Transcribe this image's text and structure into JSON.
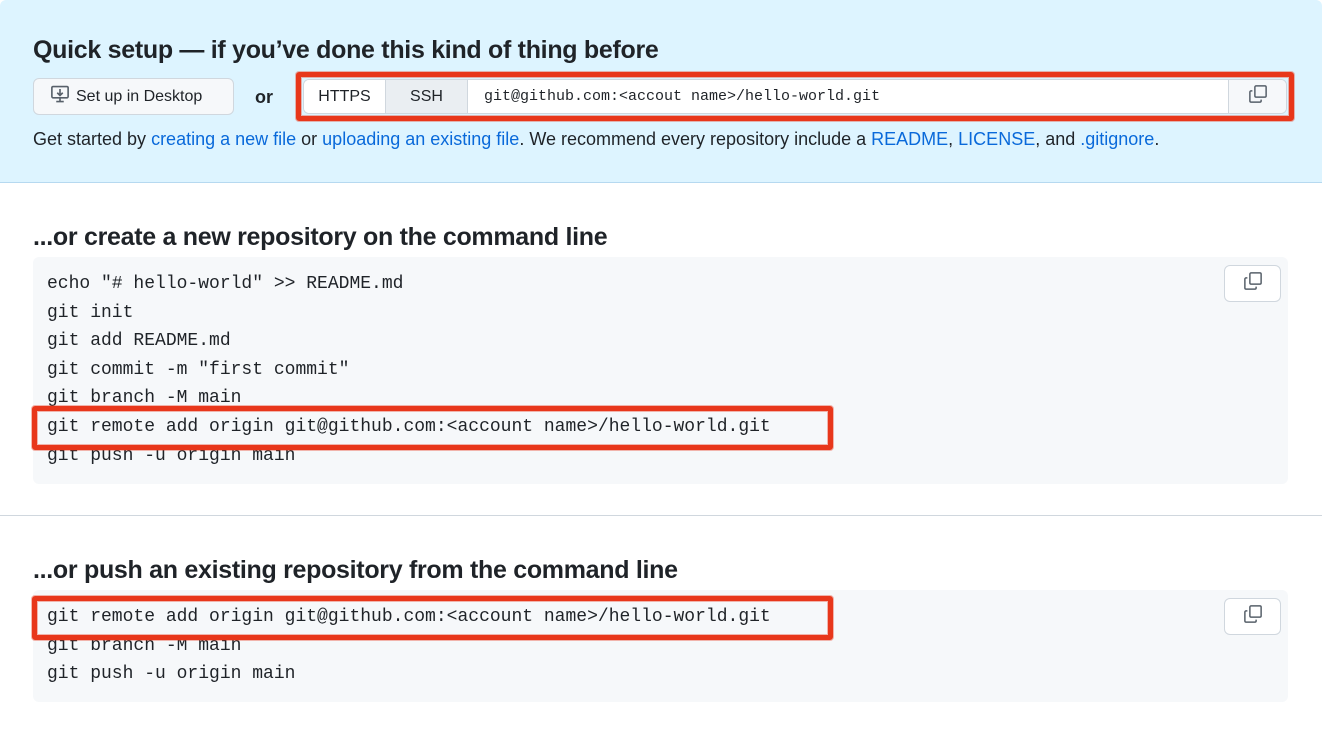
{
  "quick_setup": {
    "title": "Quick setup — if you’ve done this kind of thing before",
    "desktop_button_label": "Set up in Desktop",
    "or_label": "or",
    "protocols": [
      "HTTPS",
      "SSH"
    ],
    "selected_protocol": "SSH",
    "clone_url": "git@github.com:<accout name>/hello-world.git",
    "help": {
      "t1": "Get started by ",
      "link_new_file": "creating a new file",
      "t2": " or ",
      "link_upload": "uploading an existing file",
      "t3": ". We recommend every repository include a ",
      "link_readme": "README",
      "t4": ", ",
      "link_license": "LICENSE",
      "t5": ", and ",
      "link_gitignore": ".gitignore",
      "t6": "."
    }
  },
  "new_repo": {
    "title": "...or create a new repository on the command line",
    "lines": [
      "echo \"# hello-world\" >> README.md",
      "git init",
      "git add README.md",
      "git commit -m \"first commit\"",
      "git branch -M main",
      "git remote add origin git@github.com:<account name>/hello-world.git",
      "git push -u origin main"
    ]
  },
  "push_existing": {
    "title": "...or push an existing repository from the command line",
    "lines": [
      "git remote add origin git@github.com:<account name>/hello-world.git",
      "git branch -M main",
      "git push -u origin main"
    ]
  },
  "icons": {
    "desktop": "desktop-download-icon",
    "copy": "copy-icon"
  },
  "colors": {
    "quick_setup_bg": "#ddf4ff",
    "link": "#0969da",
    "highlight": "#e8371b",
    "code_bg": "#f6f8fa"
  }
}
